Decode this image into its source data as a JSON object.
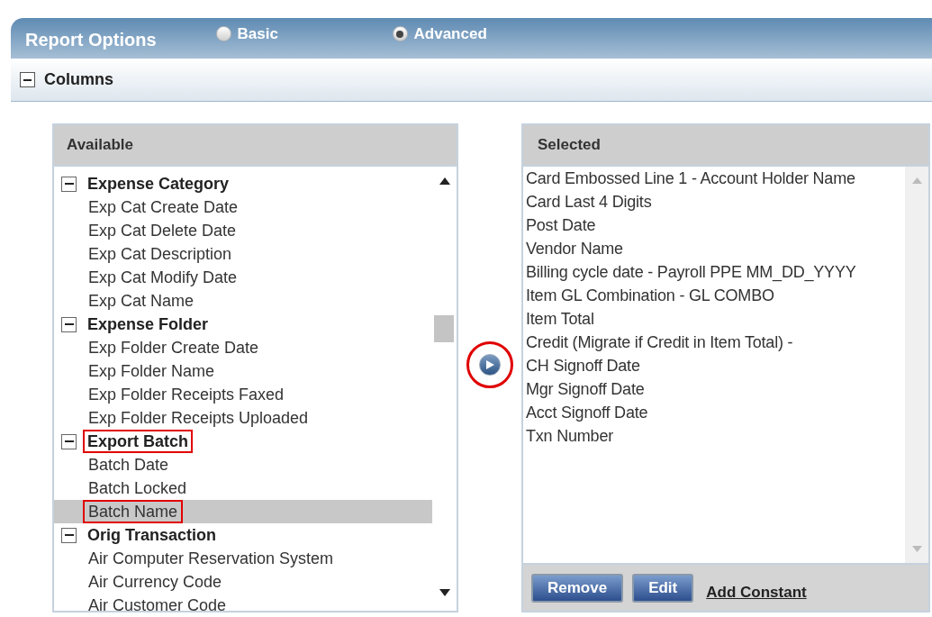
{
  "header": {
    "title": "Report Options",
    "modes": [
      {
        "label": "Basic",
        "selected": false
      },
      {
        "label": "Advanced",
        "selected": true
      }
    ]
  },
  "section": {
    "title": "Columns",
    "expanded": true
  },
  "available": {
    "title": "Available",
    "groups": [
      {
        "label": "Expense Category",
        "expanded": true,
        "annotated": false,
        "children": [
          {
            "label": "Exp Cat Create Date",
            "selected": false,
            "annotated": false
          },
          {
            "label": "Exp Cat Delete Date",
            "selected": false,
            "annotated": false
          },
          {
            "label": "Exp Cat Description",
            "selected": false,
            "annotated": false
          },
          {
            "label": "Exp Cat Modify Date",
            "selected": false,
            "annotated": false
          },
          {
            "label": "Exp Cat Name",
            "selected": false,
            "annotated": false
          }
        ]
      },
      {
        "label": "Expense Folder",
        "expanded": true,
        "annotated": false,
        "children": [
          {
            "label": "Exp Folder Create Date",
            "selected": false,
            "annotated": false
          },
          {
            "label": "Exp Folder Name",
            "selected": false,
            "annotated": false
          },
          {
            "label": "Exp Folder Receipts Faxed",
            "selected": false,
            "annotated": false
          },
          {
            "label": "Exp Folder Receipts Uploaded",
            "selected": false,
            "annotated": false
          }
        ]
      },
      {
        "label": "Export Batch",
        "expanded": true,
        "annotated": true,
        "children": [
          {
            "label": "Batch Date",
            "selected": false,
            "annotated": false
          },
          {
            "label": "Batch Locked",
            "selected": false,
            "annotated": false
          },
          {
            "label": "Batch Name",
            "selected": true,
            "annotated": true
          }
        ]
      },
      {
        "label": "Orig Transaction",
        "expanded": true,
        "annotated": false,
        "children": [
          {
            "label": "Air Computer Reservation System",
            "selected": false,
            "annotated": false
          },
          {
            "label": "Air Currency Code",
            "selected": false,
            "annotated": false
          },
          {
            "label": "Air Customer Code",
            "selected": false,
            "annotated": false
          }
        ]
      }
    ]
  },
  "add_button": {
    "annotated": true
  },
  "selected": {
    "title": "Selected",
    "items": [
      "Card Embossed Line 1 - Account Holder Name",
      "Card Last 4 Digits",
      "Post Date",
      "Vendor Name",
      "Billing cycle date - Payroll PPE MM_DD_YYYY",
      "Item GL Combination - GL COMBO",
      "Item Total",
      "Credit (Migrate if Credit in Item Total) -",
      "CH Signoff Date",
      "Mgr Signoff Date",
      "Acct Signoff Date",
      "Txn Number"
    ],
    "buttons": [
      "Remove",
      "Edit"
    ],
    "link": "Add Constant"
  }
}
